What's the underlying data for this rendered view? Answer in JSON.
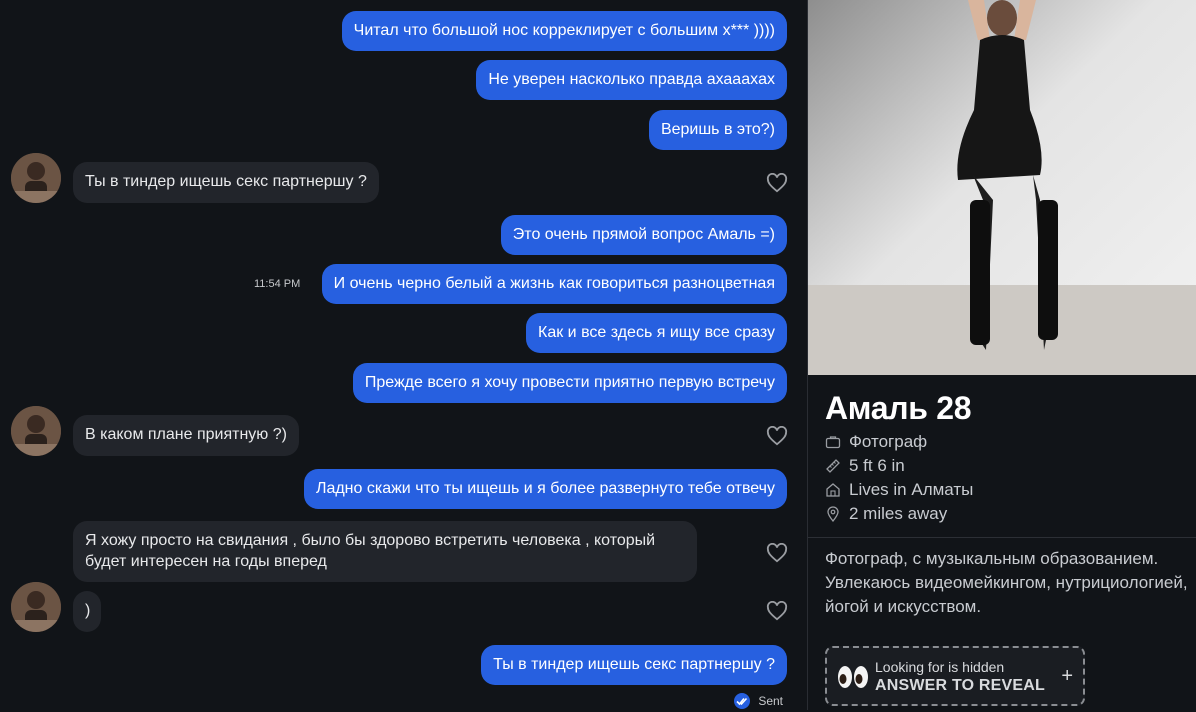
{
  "messages": [
    {
      "dir": "out",
      "text": "Читал что большой нос корреклирует с большим х*** ))))"
    },
    {
      "dir": "out",
      "text": "Не уверен насколько правда ахаааxах"
    },
    {
      "dir": "out",
      "text": "Веришь в это?)"
    },
    {
      "dir": "in",
      "text": "Ты в тиндер ищешь секс партнершу ?"
    },
    {
      "dir": "out",
      "text": "Это очень прямой вопрос Амаль =)"
    },
    {
      "dir": "out",
      "text": "И очень черно белый а жизнь как говориться разноцветная",
      "time": "11:54 PM"
    },
    {
      "dir": "out",
      "text": "Как и все здесь я ищу все сразу"
    },
    {
      "dir": "out",
      "text": "Прежде всего я хочу провести приятно первую встречу"
    },
    {
      "dir": "in",
      "text": "В каком плане приятную ?)"
    },
    {
      "dir": "out",
      "text": "Ладно скажи что ты ищешь и я более развернуто тебе отвечу"
    },
    {
      "dir": "in",
      "text": "Я хожу просто на свидания , было бы здорово встретить человека , который будет интересен на годы вперед"
    },
    {
      "dir": "in",
      "text": ")"
    },
    {
      "dir": "out",
      "text": "Ты в тиндер ищешь секс партнершу ?"
    }
  ],
  "status": {
    "sent_label": "Sent"
  },
  "profile": {
    "name_age": "Амаль 28",
    "job": "Фотограф",
    "height": "5 ft 6 in",
    "lives": "Lives in Алматы",
    "distance": "2 miles away",
    "bio": "Фотограф, с музыкальным образованием. Увлекаюсь видеомейкингом, нутрициологией, йогой и искусством.",
    "reveal_line1": "Looking for is hidden",
    "reveal_line2": "ANSWER TO REVEAL",
    "reveal_plus": "+"
  },
  "icons": {
    "heart": "heart-outline-icon",
    "job": "briefcase-icon",
    "height": "ruler-icon",
    "home": "home-icon",
    "location": "location-pin-icon",
    "eyes": "eyes-emoji-icon",
    "sent": "double-check-icon"
  },
  "colors": {
    "outgoing_bubble": "#2760e0",
    "incoming_bubble": "#22252b",
    "background": "#111418"
  }
}
